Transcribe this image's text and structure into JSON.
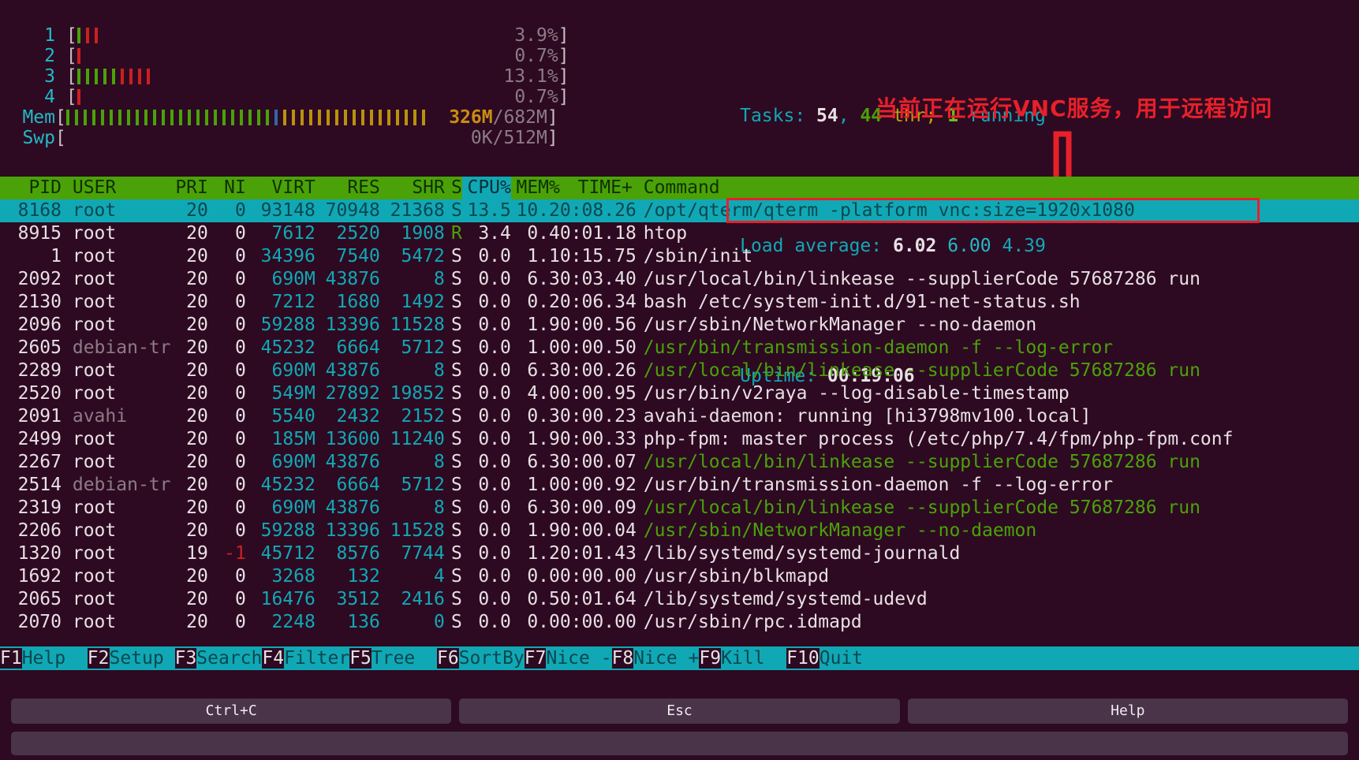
{
  "meters": {
    "cpus": [
      {
        "label": "1",
        "percent": "3.9%",
        "green": 1,
        "red": 2
      },
      {
        "label": "2",
        "percent": "0.7%",
        "green": 0,
        "red": 1
      },
      {
        "label": "3",
        "percent": "13.1%",
        "green": 5,
        "red": 4
      },
      {
        "label": "4",
        "percent": "0.7%",
        "green": 0,
        "red": 1
      }
    ],
    "mem": {
      "label": "Mem",
      "used": "326M",
      "total": "/682M",
      "green": 24,
      "blue": 1,
      "yellow": 17
    },
    "swap": {
      "label": "Swp",
      "used": "0K",
      "total": "/512M"
    }
  },
  "stats": {
    "tasks_label": "Tasks: ",
    "tasks_total": "54",
    "tasks_sep": ", ",
    "thr_count": "44",
    "thr_label": " thr; ",
    "running_count": "1",
    "running_label": " running",
    "load_label": "Load average: ",
    "load_1": "6.02",
    "load_5": "6.00",
    "load_15": "4.39",
    "uptime_label": "Uptime: ",
    "uptime_value": "00:19:06"
  },
  "annotation": {
    "text": "当前正在运行VNC服务，用于远程访问",
    "color": "#e8202a",
    "arrow": "down-arrow",
    "highlight_box_color": "#e8202a"
  },
  "table": {
    "columns": [
      "PID",
      "USER",
      "PRI",
      "NI",
      "VIRT",
      "RES",
      "SHR",
      "S",
      "CPU%",
      "MEM%",
      "TIME+",
      "Command"
    ],
    "sort_column": "CPU%",
    "selected_index": 0,
    "rows": [
      {
        "pid": "8168",
        "user": "root",
        "pri": "20",
        "ni": "0",
        "virt": "93148",
        "res": "70948",
        "shr": "21368",
        "s": "S",
        "cpu": "13.5",
        "mem": "10.2",
        "time": "0:08.26",
        "cmd": "/opt/qterm/qterm -platform vnc:size=1920x1080",
        "cmd_color": "sel",
        "user_color": "sel",
        "s_color": "sel",
        "ni_color": "sel",
        "selected": true,
        "boxed": true
      },
      {
        "pid": "8915",
        "user": "root",
        "pri": "20",
        "ni": "0",
        "virt": "7612",
        "res": "2520",
        "shr": "1908",
        "s": "R",
        "cpu": "3.4",
        "mem": "0.4",
        "time": "0:01.18",
        "cmd": "htop",
        "cmd_color": "white",
        "user_color": "white",
        "s_color": "green",
        "ni_color": "white"
      },
      {
        "pid": "1",
        "user": "root",
        "pri": "20",
        "ni": "0",
        "virt": "34396",
        "res": "7540",
        "shr": "5472",
        "s": "S",
        "cpu": "0.0",
        "mem": "1.1",
        "time": "0:15.75",
        "cmd": "/sbin/init",
        "cmd_color": "white",
        "user_color": "white",
        "s_color": "white",
        "ni_color": "white"
      },
      {
        "pid": "2092",
        "user": "root",
        "pri": "20",
        "ni": "0",
        "virt": "690M",
        "res": "43876",
        "shr": "8",
        "s": "S",
        "cpu": "0.0",
        "mem": "6.3",
        "time": "0:03.40",
        "cmd": "/usr/local/bin/linkease --supplierCode 57687286 run",
        "cmd_color": "white",
        "user_color": "white",
        "s_color": "white",
        "ni_color": "white"
      },
      {
        "pid": "2130",
        "user": "root",
        "pri": "20",
        "ni": "0",
        "virt": "7212",
        "res": "1680",
        "shr": "1492",
        "s": "S",
        "cpu": "0.0",
        "mem": "0.2",
        "time": "0:06.34",
        "cmd": "bash /etc/system-init.d/91-net-status.sh",
        "cmd_color": "white",
        "user_color": "white",
        "s_color": "white",
        "ni_color": "white"
      },
      {
        "pid": "2096",
        "user": "root",
        "pri": "20",
        "ni": "0",
        "virt": "59288",
        "res": "13396",
        "shr": "11528",
        "s": "S",
        "cpu": "0.0",
        "mem": "1.9",
        "time": "0:00.56",
        "cmd": "/usr/sbin/NetworkManager --no-daemon",
        "cmd_color": "white",
        "user_color": "white",
        "s_color": "white",
        "ni_color": "white"
      },
      {
        "pid": "2605",
        "user": "debian-tr",
        "pri": "20",
        "ni": "0",
        "virt": "45232",
        "res": "6664",
        "shr": "5712",
        "s": "S",
        "cpu": "0.0",
        "mem": "1.0",
        "time": "0:00.50",
        "cmd": "/usr/bin/transmission-daemon -f --log-error",
        "cmd_color": "green",
        "user_color": "gray",
        "s_color": "white",
        "ni_color": "white"
      },
      {
        "pid": "2289",
        "user": "root",
        "pri": "20",
        "ni": "0",
        "virt": "690M",
        "res": "43876",
        "shr": "8",
        "s": "S",
        "cpu": "0.0",
        "mem": "6.3",
        "time": "0:00.26",
        "cmd": "/usr/local/bin/linkease --supplierCode 57687286 run",
        "cmd_color": "green",
        "user_color": "white",
        "s_color": "white",
        "ni_color": "white"
      },
      {
        "pid": "2520",
        "user": "root",
        "pri": "20",
        "ni": "0",
        "virt": "549M",
        "res": "27892",
        "shr": "19852",
        "s": "S",
        "cpu": "0.0",
        "mem": "4.0",
        "time": "0:00.95",
        "cmd": "/usr/bin/v2raya --log-disable-timestamp",
        "cmd_color": "white",
        "user_color": "white",
        "s_color": "white",
        "ni_color": "white"
      },
      {
        "pid": "2091",
        "user": "avahi",
        "pri": "20",
        "ni": "0",
        "virt": "5540",
        "res": "2432",
        "shr": "2152",
        "s": "S",
        "cpu": "0.0",
        "mem": "0.3",
        "time": "0:00.23",
        "cmd": "avahi-daemon: running [hi3798mv100.local]",
        "cmd_color": "white",
        "user_color": "gray",
        "s_color": "white",
        "ni_color": "white"
      },
      {
        "pid": "2499",
        "user": "root",
        "pri": "20",
        "ni": "0",
        "virt": "185M",
        "res": "13600",
        "shr": "11240",
        "s": "S",
        "cpu": "0.0",
        "mem": "1.9",
        "time": "0:00.33",
        "cmd": "php-fpm: master process (/etc/php/7.4/fpm/php-fpm.conf",
        "cmd_color": "white",
        "user_color": "white",
        "s_color": "white",
        "ni_color": "white"
      },
      {
        "pid": "2267",
        "user": "root",
        "pri": "20",
        "ni": "0",
        "virt": "690M",
        "res": "43876",
        "shr": "8",
        "s": "S",
        "cpu": "0.0",
        "mem": "6.3",
        "time": "0:00.07",
        "cmd": "/usr/local/bin/linkease --supplierCode 57687286 run",
        "cmd_color": "green",
        "user_color": "white",
        "s_color": "white",
        "ni_color": "white"
      },
      {
        "pid": "2514",
        "user": "debian-tr",
        "pri": "20",
        "ni": "0",
        "virt": "45232",
        "res": "6664",
        "shr": "5712",
        "s": "S",
        "cpu": "0.0",
        "mem": "1.0",
        "time": "0:00.92",
        "cmd": "/usr/bin/transmission-daemon -f --log-error",
        "cmd_color": "white",
        "user_color": "gray",
        "s_color": "white",
        "ni_color": "white"
      },
      {
        "pid": "2319",
        "user": "root",
        "pri": "20",
        "ni": "0",
        "virt": "690M",
        "res": "43876",
        "shr": "8",
        "s": "S",
        "cpu": "0.0",
        "mem": "6.3",
        "time": "0:00.09",
        "cmd": "/usr/local/bin/linkease --supplierCode 57687286 run",
        "cmd_color": "green",
        "user_color": "white",
        "s_color": "white",
        "ni_color": "white"
      },
      {
        "pid": "2206",
        "user": "root",
        "pri": "20",
        "ni": "0",
        "virt": "59288",
        "res": "13396",
        "shr": "11528",
        "s": "S",
        "cpu": "0.0",
        "mem": "1.9",
        "time": "0:00.04",
        "cmd": "/usr/sbin/NetworkManager --no-daemon",
        "cmd_color": "green",
        "user_color": "white",
        "s_color": "white",
        "ni_color": "white"
      },
      {
        "pid": "1320",
        "user": "root",
        "pri": "19",
        "ni": "-1",
        "virt": "45712",
        "res": "8576",
        "shr": "7744",
        "s": "S",
        "cpu": "0.0",
        "mem": "1.2",
        "time": "0:01.43",
        "cmd": "/lib/systemd/systemd-journald",
        "cmd_color": "white",
        "user_color": "white",
        "s_color": "white",
        "ni_color": "red"
      },
      {
        "pid": "1692",
        "user": "root",
        "pri": "20",
        "ni": "0",
        "virt": "3268",
        "res": "132",
        "shr": "4",
        "s": "S",
        "cpu": "0.0",
        "mem": "0.0",
        "time": "0:00.00",
        "cmd": "/usr/sbin/blkmapd",
        "cmd_color": "white",
        "user_color": "white",
        "s_color": "white",
        "ni_color": "white"
      },
      {
        "pid": "2065",
        "user": "root",
        "pri": "20",
        "ni": "0",
        "virt": "16476",
        "res": "3512",
        "shr": "2416",
        "s": "S",
        "cpu": "0.0",
        "mem": "0.5",
        "time": "0:01.64",
        "cmd": "/lib/systemd/systemd-udevd",
        "cmd_color": "white",
        "user_color": "white",
        "s_color": "white",
        "ni_color": "white"
      },
      {
        "pid": "2070",
        "user": "root",
        "pri": "20",
        "ni": "0",
        "virt": "2248",
        "res": "136",
        "shr": "0",
        "s": "S",
        "cpu": "0.0",
        "mem": "0.0",
        "time": "0:00.00",
        "cmd": "/usr/sbin/rpc.idmapd",
        "cmd_color": "white",
        "user_color": "white",
        "s_color": "white",
        "ni_color": "white"
      }
    ]
  },
  "fnbar": [
    {
      "key": "F1",
      "label": "Help  "
    },
    {
      "key": "F2",
      "label": "Setup "
    },
    {
      "key": "F3",
      "label": "Search"
    },
    {
      "key": "F4",
      "label": "Filter"
    },
    {
      "key": "F5",
      "label": "Tree  "
    },
    {
      "key": "F6",
      "label": "SortBy"
    },
    {
      "key": "F7",
      "label": "Nice -"
    },
    {
      "key": "F8",
      "label": "Nice +"
    },
    {
      "key": "F9",
      "label": "Kill  "
    },
    {
      "key": "F10",
      "label": "Quit"
    }
  ],
  "bottom_buttons": [
    {
      "label": "Ctrl+C"
    },
    {
      "label": "Esc"
    },
    {
      "label": "Help"
    }
  ],
  "input_bar": {
    "value": "",
    "placeholder": ""
  }
}
